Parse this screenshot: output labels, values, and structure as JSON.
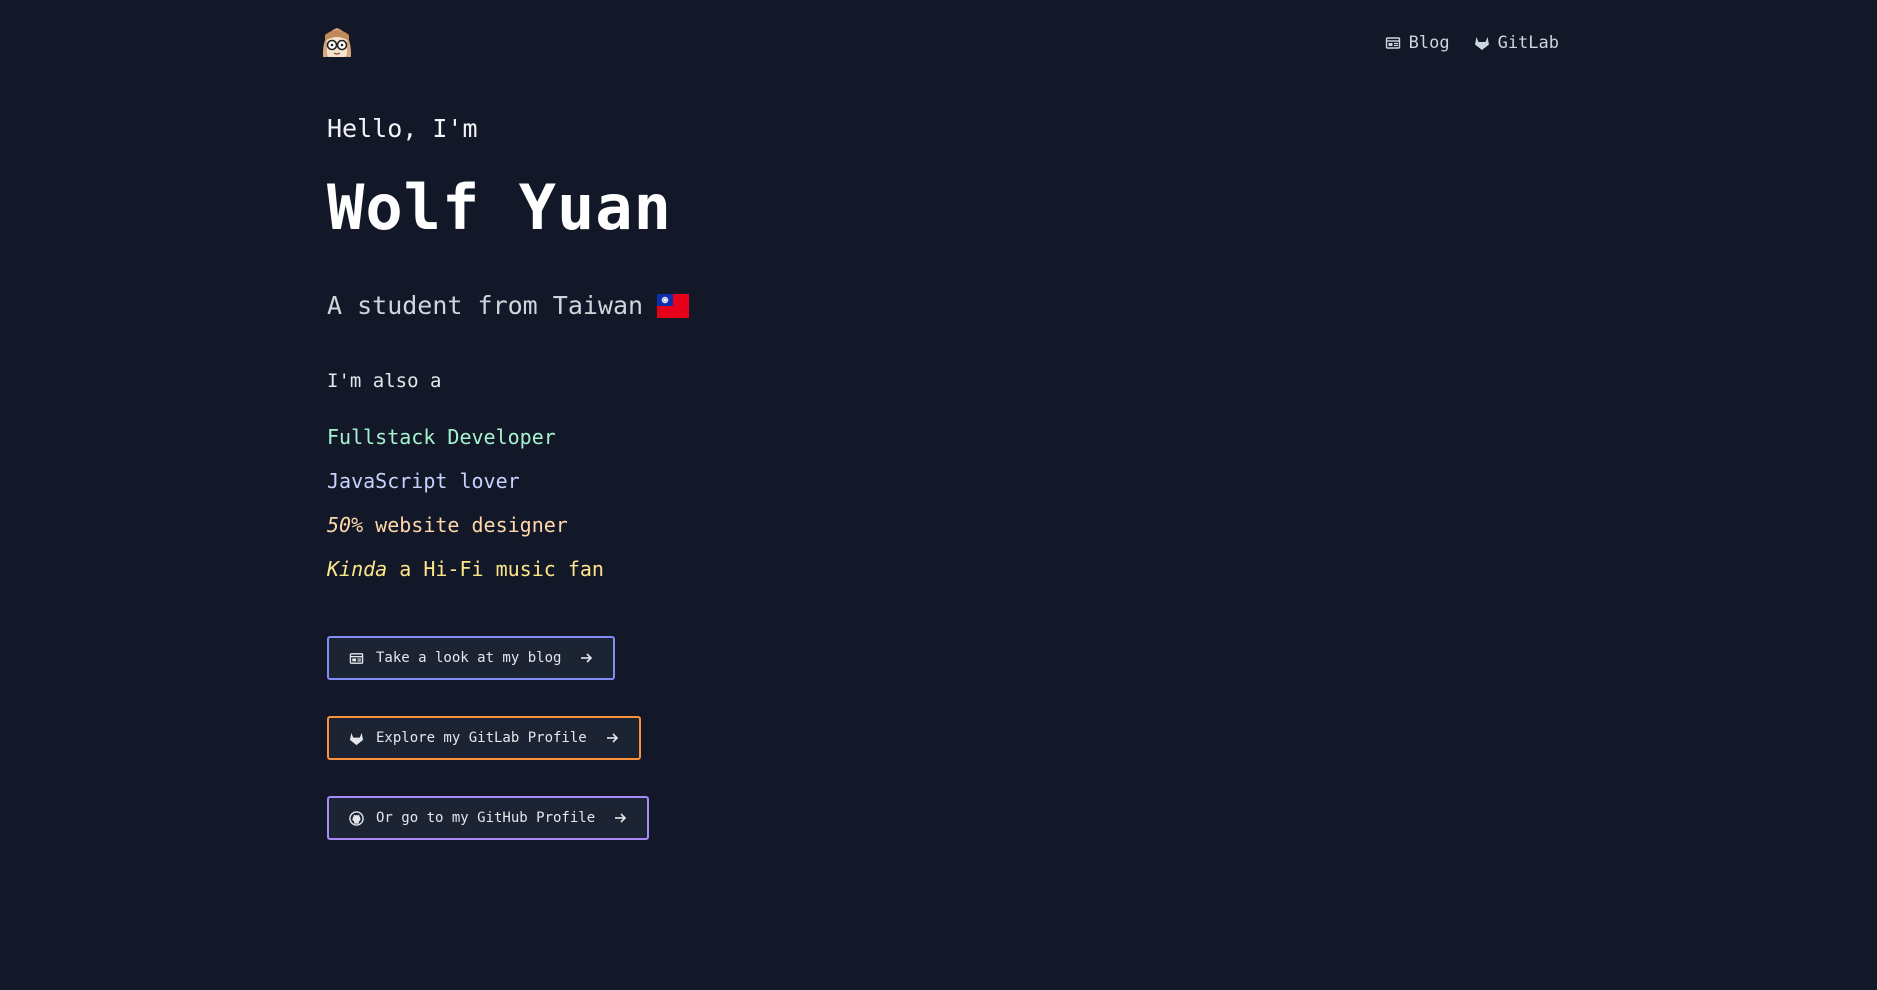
{
  "nav": {
    "blog_label": "Blog",
    "gitlab_label": "GitLab"
  },
  "hero": {
    "greeting": "Hello, I'm",
    "name": "Wolf Yuan",
    "tagline": "A student from Taiwan",
    "also": "I'm also a"
  },
  "roles": [
    {
      "prefix": "",
      "text": "Fullstack Developer",
      "color": "#a7f3d0"
    },
    {
      "prefix": "",
      "text": "JavaScript lover",
      "color": "#c7d2fe"
    },
    {
      "prefix": "50%",
      "text": " website designer",
      "color": "#fed7aa"
    },
    {
      "prefix": "Kinda",
      "text": " a Hi-Fi music fan",
      "color": "#fde68a"
    }
  ],
  "buttons": {
    "blog": "Take a look at my blog",
    "gitlab": "Explore my GitLab Profile",
    "github": "Or go to my GitHub Profile"
  },
  "colors": {
    "background": "#121827",
    "blog_border": "#818cf8",
    "gitlab_border": "#fb923c",
    "github_border": "#a78bfa"
  },
  "icons": [
    "avatar",
    "newspaper-icon",
    "gitlab-icon",
    "github-icon",
    "arrow-right-icon",
    "taiwan-flag-icon"
  ]
}
